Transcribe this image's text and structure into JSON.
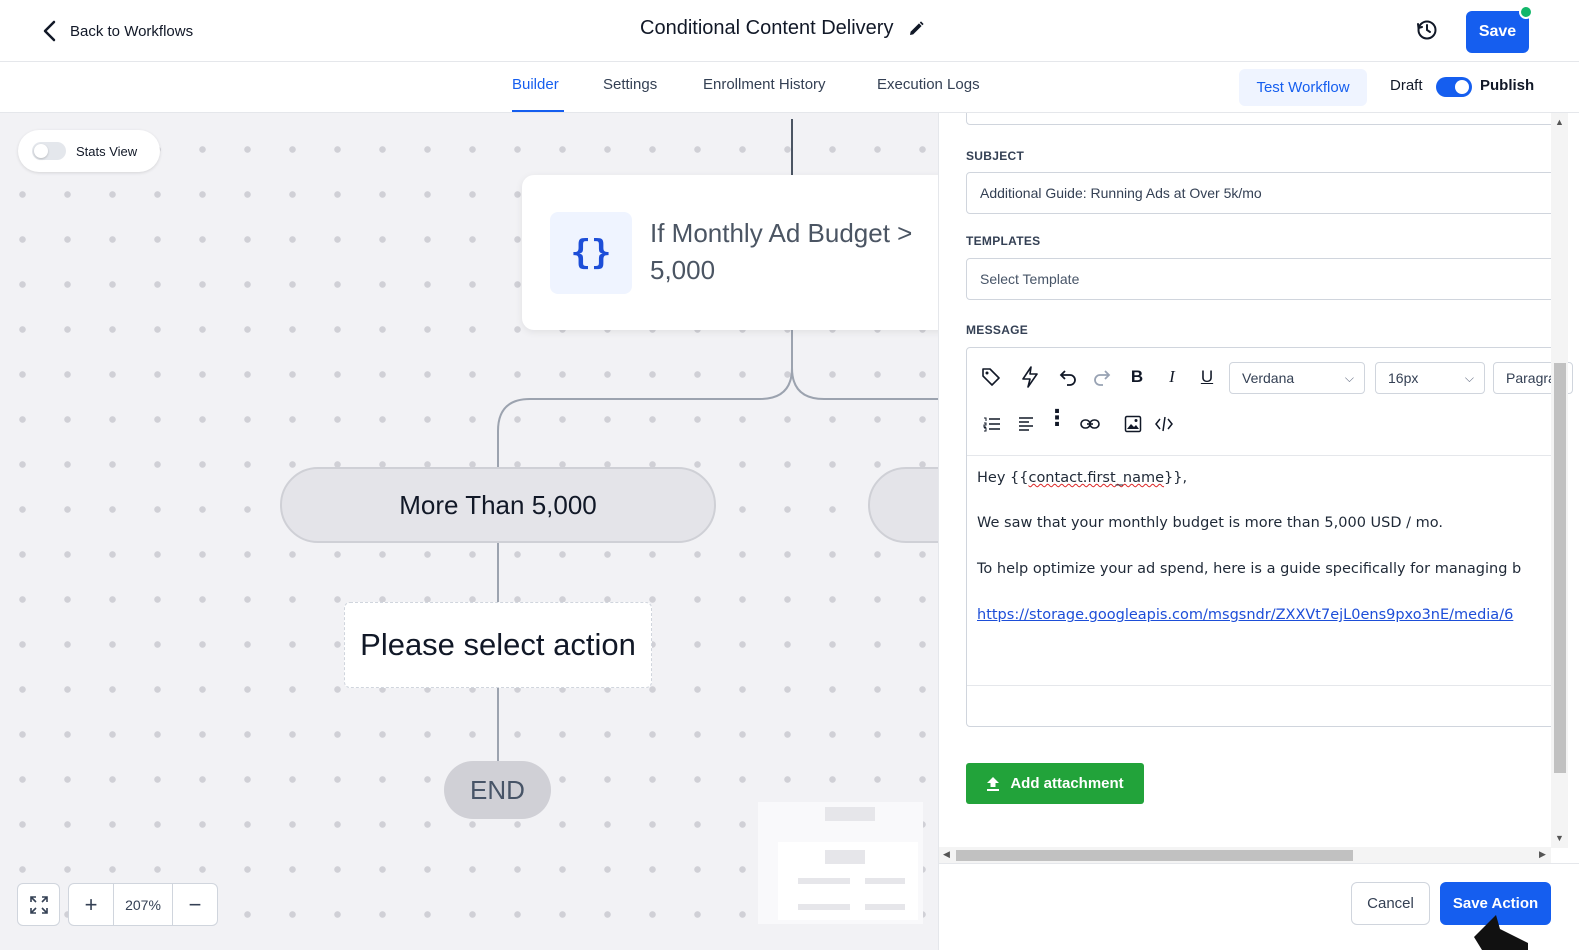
{
  "header": {
    "back_label": "Back to Workflows",
    "title": "Conditional Content Delivery",
    "save_label": "Save",
    "status_color": "#12b76a"
  },
  "tabs": {
    "items": [
      {
        "label": "Builder",
        "active": true
      },
      {
        "label": "Settings",
        "active": false
      },
      {
        "label": "Enrollment History",
        "active": false
      },
      {
        "label": "Execution Logs",
        "active": false
      }
    ],
    "test_label": "Test Workflow",
    "draft_label": "Draft",
    "publish_label": "Publish",
    "published": true
  },
  "canvas": {
    "stats_label": "Stats View",
    "stats_on": false,
    "condition_text": "If Monthly Ad Budget > 5,000",
    "condition_icon": "{}",
    "branch_label": "More Than 5,000",
    "action_placeholder": "Please select action",
    "end_label": "END",
    "zoom": "207%",
    "zoom_in": "+",
    "zoom_out": "−"
  },
  "panel": {
    "subject_label": "SUBJECT",
    "subject_value": "Additional Guide: Running Ads at Over 5k/mo",
    "templates_label": "TEMPLATES",
    "templates_placeholder": "Select Template",
    "message_label": "MESSAGE",
    "font_family": "Verdana",
    "font_size": "16px",
    "block_format": "Paragra",
    "message": {
      "greeting_prefix": "Hey {{",
      "greeting_var": "contact.first_name",
      "greeting_suffix": "}},",
      "line2": "We saw that your monthly budget is more than 5,000 USD / mo.",
      "line3": "To help optimize your ad spend, here is a guide specifically for managing b",
      "link": "https://storage.googleapis.com/msgsndr/ZXXVt7ejL0ens9pxo3nE/media/6"
    },
    "attach_label": "Add attachment",
    "cancel_label": "Cancel",
    "save_action_label": "Save Action"
  },
  "colors": {
    "primary": "#155eef",
    "success": "#22a33a",
    "link": "#1d4ed8"
  }
}
